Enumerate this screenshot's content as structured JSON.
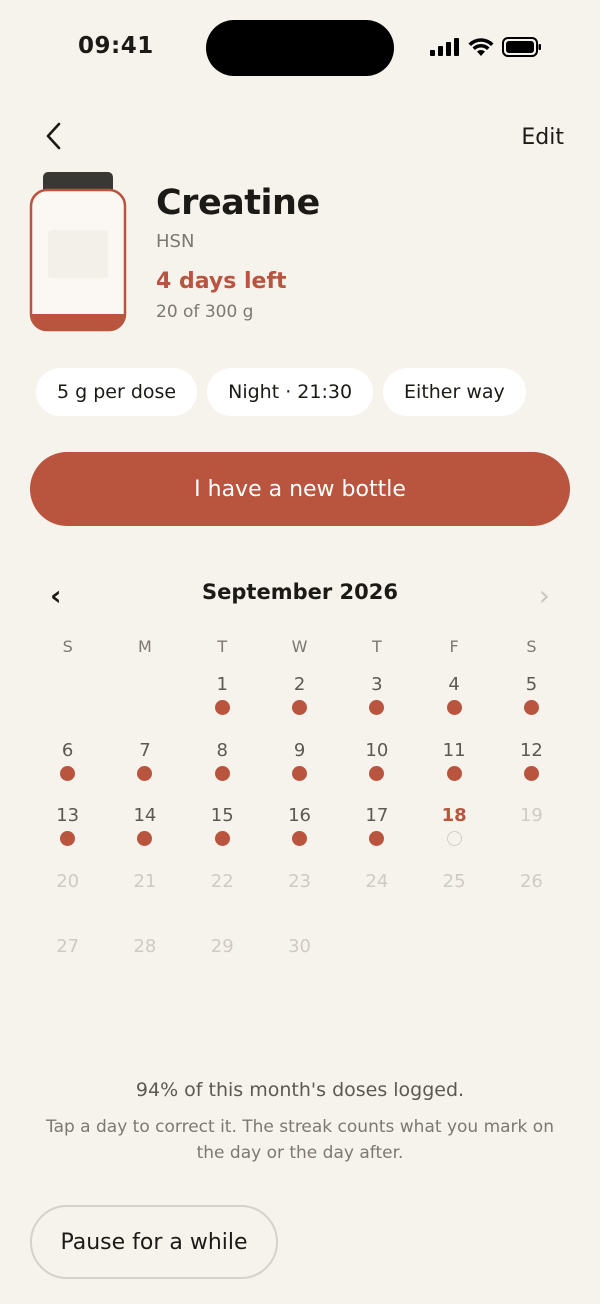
{
  "status_bar": {
    "time": "09:41"
  },
  "nav": {
    "back_icon": "chevron-left-icon",
    "edit_label": "Edit"
  },
  "supplement": {
    "name": "Creatine",
    "brand": "HSN",
    "days_left": "4 days left",
    "amount": "20 of 300 g",
    "remaining_fraction": 0.0667,
    "colors": {
      "accent": "#b9543e",
      "lid": "#3a3835"
    }
  },
  "chips": [
    {
      "label": "5 g per dose"
    },
    {
      "label": "Night · 21:30"
    },
    {
      "label": "Either way"
    }
  ],
  "primary_button": {
    "label": "I have a new bottle"
  },
  "calendar": {
    "month_label": "September 2026",
    "prev_icon": "chevron-left-icon",
    "next_icon": "chevron-right-icon",
    "weekdays": [
      "S",
      "M",
      "T",
      "W",
      "T",
      "F",
      "S"
    ],
    "first_weekday_index": 2,
    "days": [
      {
        "n": "1",
        "state": "logged"
      },
      {
        "n": "2",
        "state": "logged"
      },
      {
        "n": "3",
        "state": "logged"
      },
      {
        "n": "4",
        "state": "logged"
      },
      {
        "n": "5",
        "state": "logged"
      },
      {
        "n": "6",
        "state": "logged"
      },
      {
        "n": "7",
        "state": "logged"
      },
      {
        "n": "8",
        "state": "logged"
      },
      {
        "n": "9",
        "state": "logged"
      },
      {
        "n": "10",
        "state": "logged"
      },
      {
        "n": "11",
        "state": "logged"
      },
      {
        "n": "12",
        "state": "logged"
      },
      {
        "n": "13",
        "state": "logged"
      },
      {
        "n": "14",
        "state": "logged"
      },
      {
        "n": "15",
        "state": "logged"
      },
      {
        "n": "16",
        "state": "logged"
      },
      {
        "n": "17",
        "state": "logged"
      },
      {
        "n": "18",
        "state": "today"
      },
      {
        "n": "19",
        "state": "future"
      },
      {
        "n": "20",
        "state": "future"
      },
      {
        "n": "21",
        "state": "future"
      },
      {
        "n": "22",
        "state": "future"
      },
      {
        "n": "23",
        "state": "future"
      },
      {
        "n": "24",
        "state": "future"
      },
      {
        "n": "25",
        "state": "future"
      },
      {
        "n": "26",
        "state": "future"
      },
      {
        "n": "27",
        "state": "future"
      },
      {
        "n": "28",
        "state": "future"
      },
      {
        "n": "29",
        "state": "future"
      },
      {
        "n": "30",
        "state": "future"
      }
    ]
  },
  "stats_text": "94% of this month's doses logged.",
  "hint_text": "Tap a day to correct it. The streak counts what you mark on the day or the day after.",
  "pause_button": {
    "label": "Pause for a while"
  }
}
